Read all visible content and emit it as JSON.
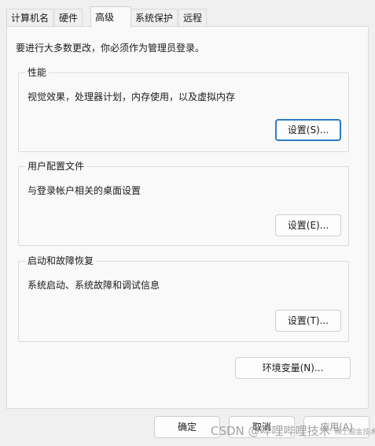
{
  "tabs": [
    {
      "label": "计算机名"
    },
    {
      "label": "硬件"
    },
    {
      "label": "高级"
    },
    {
      "label": "系统保护"
    },
    {
      "label": "远程"
    }
  ],
  "intro_text": "要进行大多数更改，你必须作为管理员登录。",
  "groups": [
    {
      "title": "性能",
      "description": "视觉效果，处理器计划，内存使用，以及虚拟内存",
      "button": "设置(S)..."
    },
    {
      "title": "用户配置文件",
      "description": "与登录帐户相关的桌面设置",
      "button": "设置(E)..."
    },
    {
      "title": "启动和故障恢复",
      "description": "系统启动、系统故障和调试信息",
      "button": "设置(T)..."
    }
  ],
  "env_button": "环境变量(N)...",
  "footer": {
    "ok": "确定",
    "cancel": "取消",
    "apply": "应用(A)"
  },
  "watermark": {
    "main": "CSDN @哔哩哔哩技术",
    "sub": "稀土掘金技术社区"
  },
  "colors": {
    "focus_border": "#2d7bc4"
  }
}
